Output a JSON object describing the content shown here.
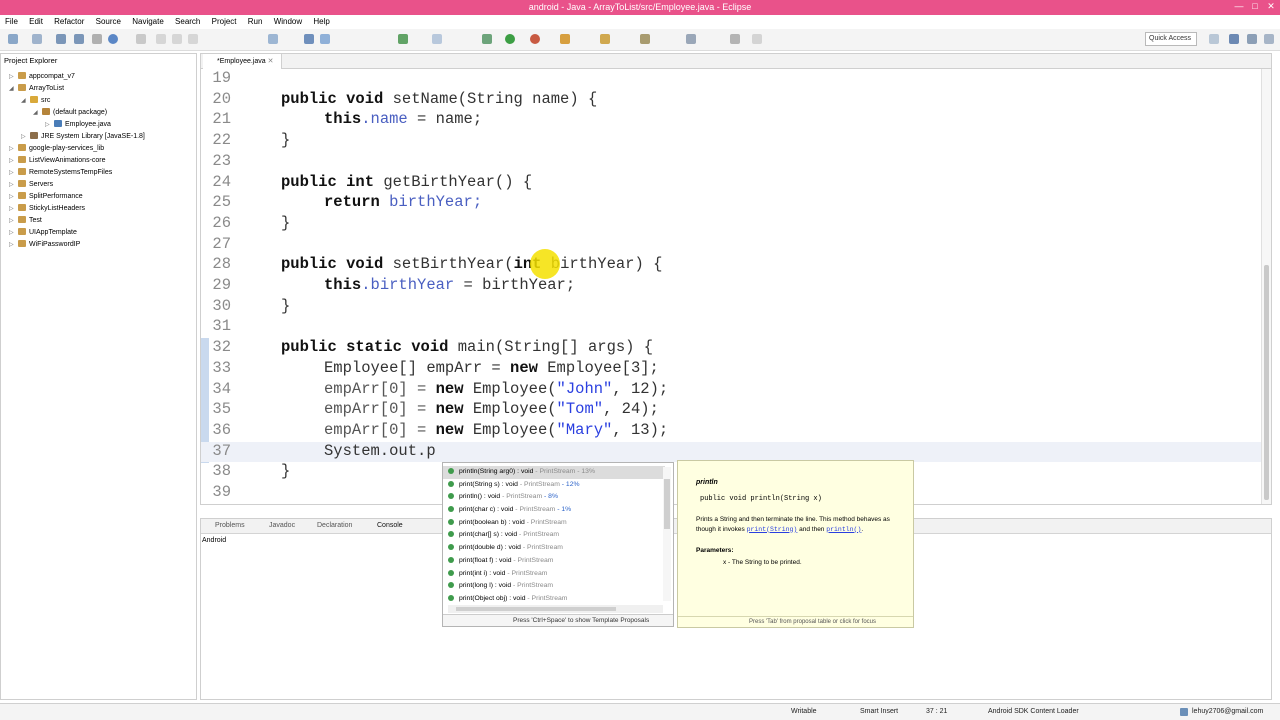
{
  "window": {
    "title": "android - Java - ArrayToList/src/Employee.java - Eclipse"
  },
  "menu": [
    "File",
    "Edit",
    "Refactor",
    "Source",
    "Navigate",
    "Search",
    "Project",
    "Run",
    "Window",
    "Help"
  ],
  "toolbar": {
    "quick_access": "Quick Access"
  },
  "explorer": {
    "tab": "Project Explorer",
    "items": [
      "appcompat_v7",
      "ArrayToList",
      "src",
      "(default package)",
      "Employee.java",
      "JRE System Library [JavaSE-1.8]",
      "google-play-services_lib",
      "ListViewAnimations-core",
      "RemoteSystemsTempFiles",
      "Servers",
      "SplitPerformance",
      "StickyListHeaders",
      "Test",
      "UIAppTemplate",
      "WiFiPasswordIP"
    ]
  },
  "editor": {
    "tab": "*Employee.java",
    "lines": {
      "l19": "19",
      "l20": "20",
      "l20a": "public void",
      "l20b": " setName(String name) {",
      "l21": "21",
      "l21a": "this",
      "l21b": ".name",
      "l21c": " = name;",
      "l22": "22",
      "l22a": "}",
      "l23": "23",
      "l24": "24",
      "l24a": "public int",
      "l24b": " getBirthYear() {",
      "l25": "25",
      "l25a": "return",
      "l25b": " birthYear;",
      "l26": "26",
      "l26a": "}",
      "l27": "27",
      "l28": "28",
      "l28a": "public void",
      "l28b": " setBirthYear(",
      "l28c": "int",
      "l28d": " birthYear) {",
      "l29": "29",
      "l29a": "this",
      "l29b": ".birthYear",
      "l29c": " = birthYear;",
      "l30": "30",
      "l30a": "}",
      "l31": "31",
      "l32": "32",
      "l32a": "public static void",
      "l32b": " main(String[] args) {",
      "l33": "33",
      "l33a": "Employee[] empArr = ",
      "l33b": "new",
      "l33c": " Employee[3];",
      "l34": "34",
      "l34a": "empArr[0] = ",
      "l34b": "new",
      "l34c": " Employee(",
      "l34d": "\"John\"",
      "l34e": ", 12);",
      "l35": "35",
      "l35a": "empArr[0] = ",
      "l35b": "new",
      "l35c": " Employee(",
      "l35d": "\"Tom\"",
      "l35e": ", 24);",
      "l36": "36",
      "l36a": "empArr[0] = ",
      "l36b": "new",
      "l36c": " Employee(",
      "l36d": "\"Mary\"",
      "l36e": ", 13);",
      "l37": "37",
      "l37a": "System.out.p",
      "l38": "38",
      "l38a": "}",
      "l39": "39"
    }
  },
  "console": {
    "tabs": [
      "Problems",
      "Javadoc",
      "Declaration",
      "Console"
    ],
    "label": "Android"
  },
  "proposals": {
    "items": [
      {
        "sig": "println(String arg0) : void",
        "src": " - PrintStream",
        "pct": " - 13%"
      },
      {
        "sig": "print(String s) : void",
        "src": " - PrintStream",
        "pct": " - 12%"
      },
      {
        "sig": "println() : void",
        "src": " - PrintStream",
        "pct": " - 8%"
      },
      {
        "sig": "print(char c) : void",
        "src": " - PrintStream",
        "pct": " - 1%"
      },
      {
        "sig": "print(boolean b) : void",
        "src": " - PrintStream",
        "pct": ""
      },
      {
        "sig": "print(char[] s) : void",
        "src": " - PrintStream",
        "pct": ""
      },
      {
        "sig": "print(double d) : void",
        "src": " - PrintStream",
        "pct": ""
      },
      {
        "sig": "print(float f) : void",
        "src": " - PrintStream",
        "pct": ""
      },
      {
        "sig": "print(int i) : void",
        "src": " - PrintStream",
        "pct": ""
      },
      {
        "sig": "print(long l) : void",
        "src": " - PrintStream",
        "pct": ""
      },
      {
        "sig": "print(Object obj) : void",
        "src": " - PrintStream",
        "pct": ""
      }
    ],
    "footer": "Press 'Ctrl+Space' to show Template Proposals"
  },
  "javadoc": {
    "title": "println",
    "signature": "public void println(String x)",
    "desc_a": "Prints a String and then terminate the line. This method behaves as though it invokes ",
    "desc_link": "print(String)",
    "desc_b": " and then ",
    "desc_link2": "println()",
    "desc_c": ".",
    "params_label": "Parameters:",
    "param_x": "x - The String to be printed.",
    "footer": "Press 'Tab' from proposal table or click for focus"
  },
  "status": {
    "writable": "Writable",
    "insert_mode": "Smart Insert",
    "position": "37 : 21",
    "loader": "Android SDK Content Loader",
    "user": "lehuy2706@gmail.com"
  },
  "colors": {
    "titlebar": "#e9528a",
    "keyword": "#111111",
    "field": "#4a5fc1",
    "string": "#2a3fe0",
    "tooltip_bg": "#ffffe1"
  }
}
